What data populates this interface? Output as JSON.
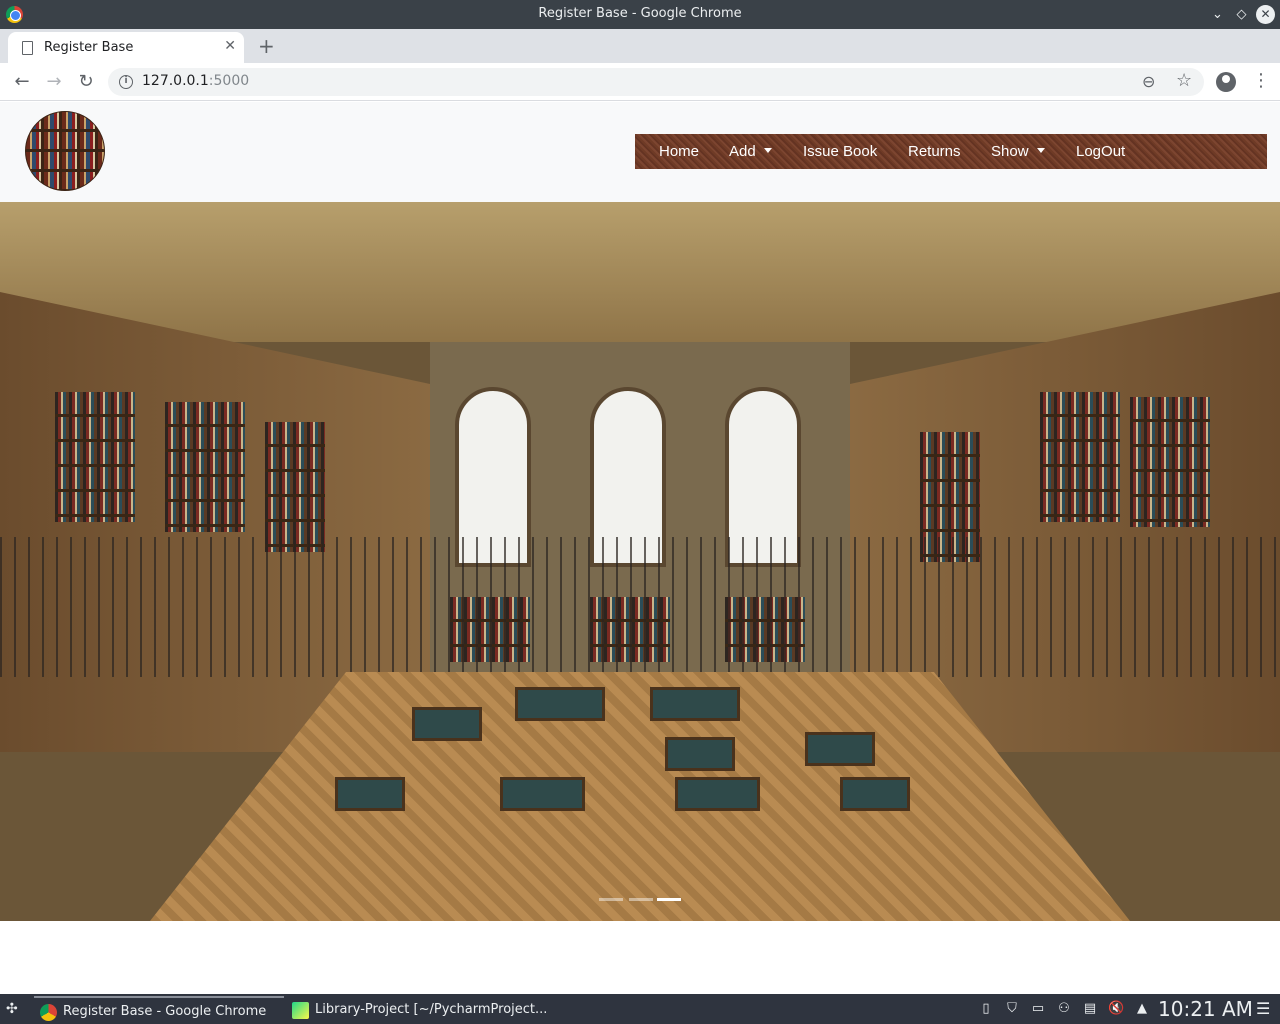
{
  "window": {
    "title": "Register Base - Google Chrome"
  },
  "browser": {
    "tab_title": "Register Base",
    "url_host": "127.0.0.1",
    "url_port": ":5000"
  },
  "site": {
    "nav": {
      "home": "Home",
      "add": "Add",
      "issue_book": "Issue Book",
      "returns": "Returns",
      "show": "Show",
      "logout": "LogOut"
    },
    "carousel": {
      "slide_count": 3,
      "active_slide": 3
    }
  },
  "taskbar": {
    "tasks": [
      {
        "label": "Register Base - Google Chrome",
        "icon": "chrome-icon"
      },
      {
        "label": "Library-Project [~/PycharmProject...",
        "icon": "pycharm-icon"
      }
    ],
    "clock": "10:21 AM"
  }
}
